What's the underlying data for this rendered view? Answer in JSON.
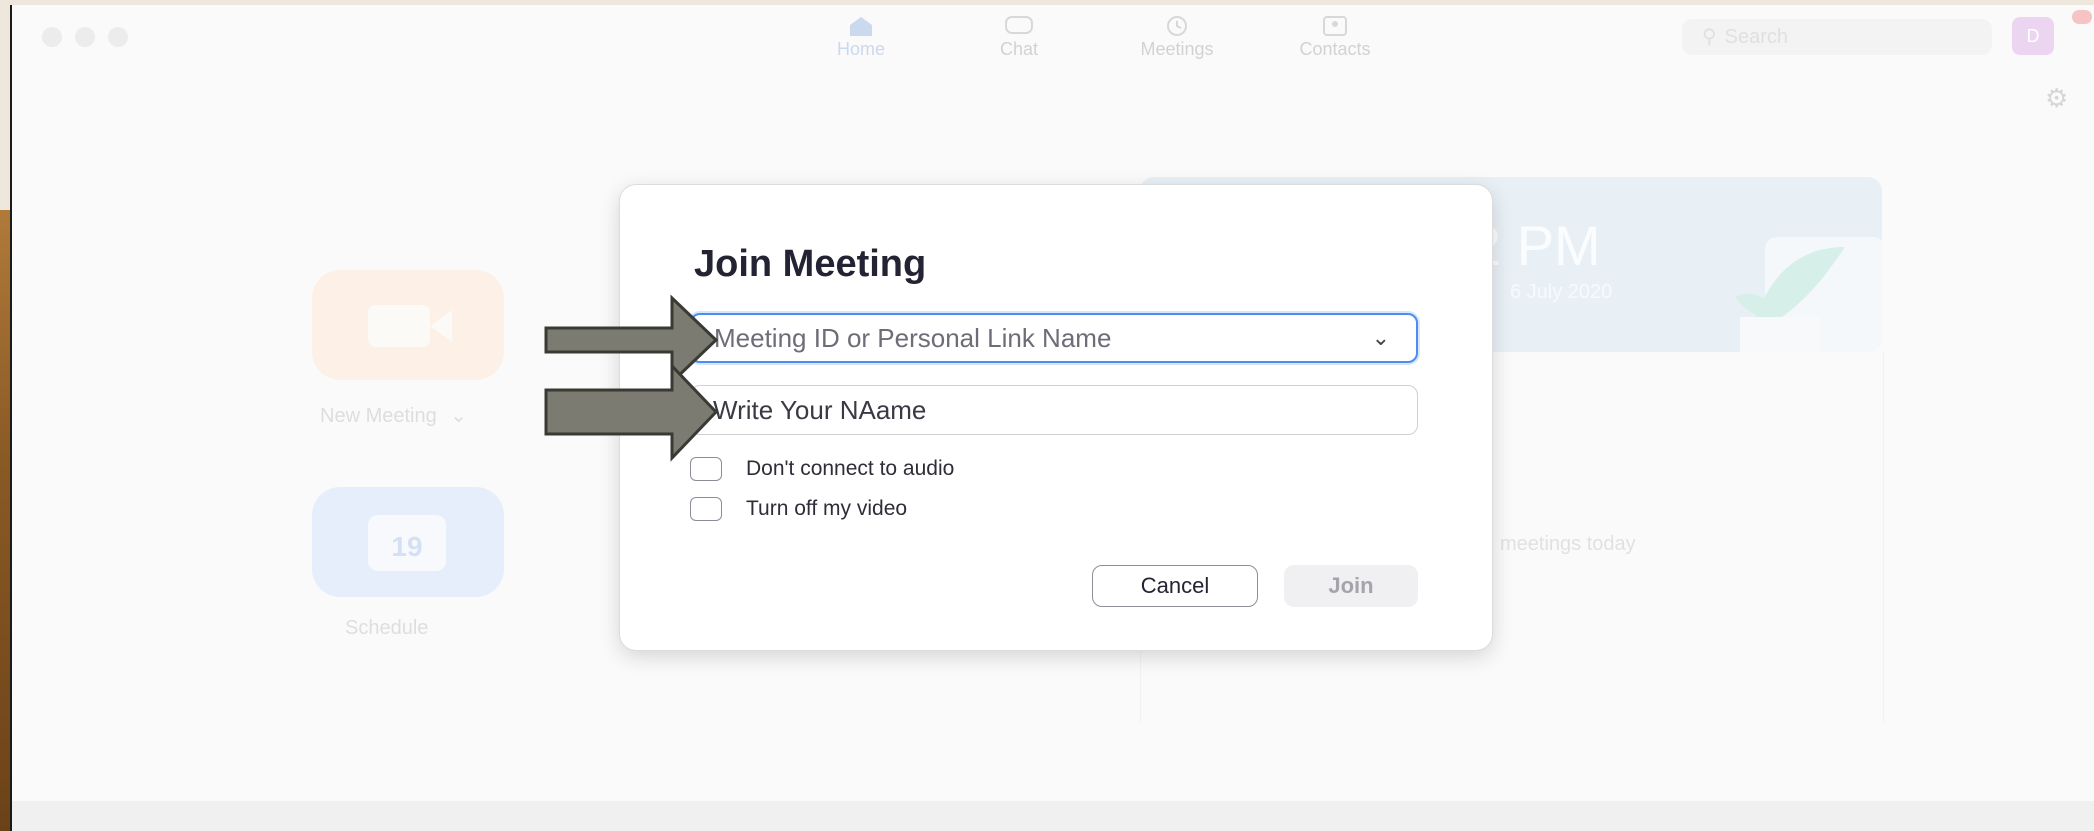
{
  "nav": {
    "home": "Home",
    "chat": "Chat",
    "meetings": "Meetings",
    "contacts": "Contacts"
  },
  "search": {
    "placeholder": "Search"
  },
  "avatar": {
    "initial": "D"
  },
  "tiles": {
    "new_meeting": "New Meeting",
    "new_meeting_chevron": "⌄",
    "schedule": "Schedule",
    "schedule_day": "19"
  },
  "card": {
    "time": "2 PM",
    "date": "6 July 2020",
    "no_meetings": "meetings today"
  },
  "dialog": {
    "title": "Join Meeting",
    "meeting_id_placeholder": "Meeting ID or Personal Link Name",
    "name_value": "Write Your NAame",
    "option_audio": "Don't connect to audio",
    "option_video": "Turn off my video",
    "cancel": "Cancel",
    "join": "Join"
  },
  "icons": {
    "home": "home-icon",
    "chat": "chat-icon",
    "meetings": "clock-icon",
    "contacts": "contact-card-icon",
    "search": "search-icon",
    "gear": "gear-icon",
    "camera": "video-camera-icon",
    "calendar": "calendar-icon",
    "chevron": "chevron-down-icon",
    "annotation_arrow": "arrow-right-icon"
  },
  "colors": {
    "accent": "#4a8ef0",
    "annotation_arrow": "#7b7b72"
  }
}
